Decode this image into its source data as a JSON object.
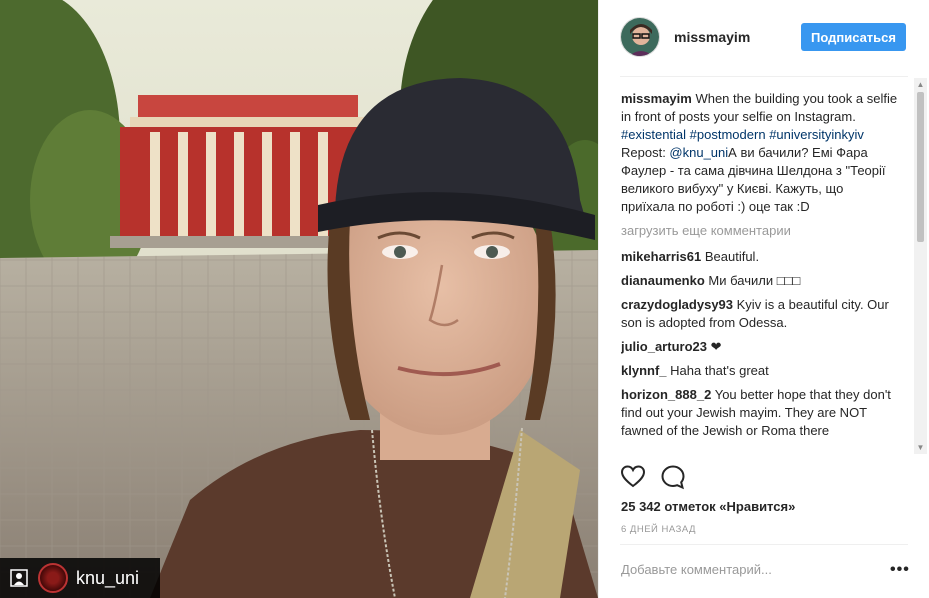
{
  "photo": {
    "repost_username": "knu_uni",
    "repost_icon": "repost-person-icon"
  },
  "header": {
    "username": "missmayim",
    "follow_label": "Подписаться"
  },
  "caption": {
    "username": "missmayim",
    "text": "When the building you took a selfie in front of posts your selfie on Instagram.",
    "hashtags": [
      "#existential",
      "#postmodern",
      "#universityinkyiv"
    ],
    "repost_prefix": "Repost: ",
    "repost_mention": "@knu_uni",
    "repost_text": "А ви бачили? Емі Фара Фаулер - та сама дівчина Шелдона з \"Теорії великого вибуху\" у Києві. Кажуть, що приїхала по роботі :) оце так :D"
  },
  "load_more": "загрузить еще комментарии",
  "comments": [
    {
      "user": "mikeharris61",
      "text": "Beautiful."
    },
    {
      "user": "dianaumenko",
      "text": "Ми бачили □□□"
    },
    {
      "user": "crazydogladysy93",
      "text": "Kyiv is a beautiful city. Our son is adopted from Odessa."
    },
    {
      "user": "julio_arturo23",
      "text": "❤"
    },
    {
      "user": "klynnf_",
      "text": "Haha that's great"
    },
    {
      "user": "horizon_888_2",
      "text": "You better hope that they don't find out your Jewish mayim. They are NOT fawned of the Jewish or Roma there"
    }
  ],
  "actions": {
    "like_icon": "heart-icon",
    "comment_icon": "comment-bubble-icon"
  },
  "likes": "25 342 отметок «Нравится»",
  "timestamp": "6 ДНЕЙ НАЗАД",
  "comment_placeholder": "Добавьте комментарий...",
  "more_options": "•••",
  "colors": {
    "follow_button": "#3897f0",
    "hashtag": "#003569",
    "muted": "#999999"
  }
}
